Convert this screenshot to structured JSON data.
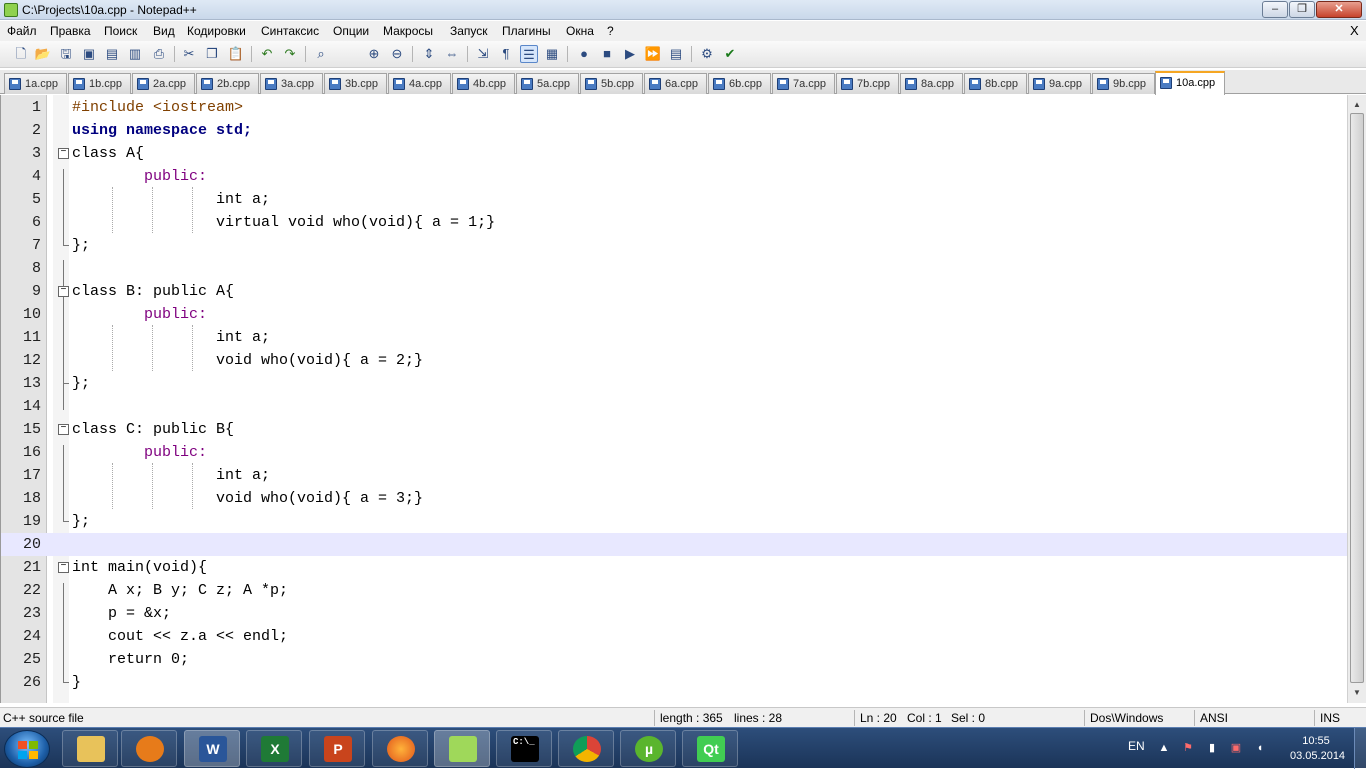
{
  "window": {
    "title": "C:\\Projects\\10a.cpp - Notepad++",
    "min_label": "–",
    "max_label": "❐",
    "close_label": "✕"
  },
  "menu": {
    "items": [
      "Файл",
      "Правка",
      "Поиск",
      "Вид",
      "Кодировки",
      "Синтаксис",
      "Опции",
      "Макросы",
      "Запуск",
      "Плагины",
      "Окна",
      "?"
    ],
    "close_label": "X"
  },
  "toolbar": {
    "icons": [
      "new-file-icon",
      "open-file-icon",
      "save-icon",
      "save-all-icon",
      "close-icon",
      "close-all-icon",
      "print-icon",
      "cut-icon",
      "copy-icon",
      "paste-icon",
      "undo-icon",
      "redo-icon",
      "find-icon",
      "zoom-in-icon",
      "zoom-out-icon",
      "sync-vertical-icon",
      "sync-horizontal-icon",
      "word-wrap-icon",
      "show-all-chars-icon",
      "indent-guide-icon",
      "user-lang-icon",
      "record-macro-icon",
      "stop-macro-icon",
      "play-macro-icon",
      "run-macro-multiple-icon",
      "save-macro-icon",
      "launch-browser-icon",
      "spell-check-icon"
    ]
  },
  "tabs": [
    "1a.cpp",
    "1b.cpp",
    "2a.cpp",
    "2b.cpp",
    "3a.cpp",
    "3b.cpp",
    "4a.cpp",
    "4b.cpp",
    "5a.cpp",
    "5b.cpp",
    "6a.cpp",
    "6b.cpp",
    "7a.cpp",
    "7b.cpp",
    "8a.cpp",
    "8b.cpp",
    "9a.cpp",
    "9b.cpp",
    "10a.cpp"
  ],
  "active_tab": "10a.cpp",
  "editor": {
    "current_line": 20,
    "lines": [
      "#include <iostream>",
      "using namespace std;",
      "class A{",
      "        public:",
      "                int a;",
      "                virtual void who(void){ a = 1;}",
      "};",
      "",
      "class B: public A{",
      "        public:",
      "                int a;",
      "                void who(void){ a = 2;}",
      "};",
      "",
      "class C: public B{",
      "        public:",
      "                int a;",
      "                void who(void){ a = 3;}",
      "};",
      "",
      "int main(void){",
      "    A x; B y; C z; A *p;",
      "    p = &x;",
      "    cout << z.a << endl;",
      "    return 0;",
      "}"
    ]
  },
  "status": {
    "file_type": "C++ source file",
    "length": "length : 365",
    "lines": "lines : 28",
    "ln": "Ln : 20",
    "col": "Col : 1",
    "sel": "Sel : 0",
    "eol": "Dos\\Windows",
    "encoding": "ANSI",
    "mode": "INS"
  },
  "taskbar": {
    "apps": [
      {
        "name": "explorer",
        "label": ""
      },
      {
        "name": "media-player",
        "label": ""
      },
      {
        "name": "word",
        "label": "W"
      },
      {
        "name": "excel",
        "label": "X"
      },
      {
        "name": "powerpoint",
        "label": "P"
      },
      {
        "name": "firefox",
        "label": ""
      },
      {
        "name": "notepad-plus-plus",
        "label": ""
      },
      {
        "name": "command-prompt",
        "label": "C:\\_"
      },
      {
        "name": "chrome",
        "label": ""
      },
      {
        "name": "utorrent",
        "label": "µ"
      },
      {
        "name": "qt-creator",
        "label": "Qt"
      }
    ],
    "language": "EN",
    "time": "10:55",
    "date": "03.05.2014"
  }
}
